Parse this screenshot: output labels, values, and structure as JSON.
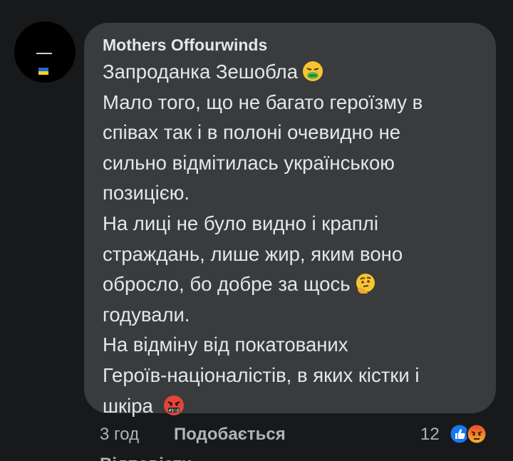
{
  "comment": {
    "author": "Mothers Offourwinds",
    "lines": [
      "Запроданка Зешобла",
      "Мало того, що не багато героїзму в",
      "співах так і в полоні очевидно не",
      "сильно відмітилась українською",
      "позицією.",
      "На лиці не було видно і краплі",
      "страждань, лише жир, яким воно",
      "обросло, бо добре за щось",
      "годували.",
      "На відміну від покатованих",
      "Героїв-націоналістів, в яких кістки і",
      "шкіра"
    ],
    "emojis": {
      "line_0": "nauseated-face-emoji",
      "line_7": "thinking-face-emoji",
      "line_11": "face-with-symbols-on-mouth-emoji"
    }
  },
  "footer": {
    "time": "3 год",
    "like_label": "Подобається",
    "reply_label": "Відповісти",
    "reaction_count": "12",
    "reaction_icons": [
      "like-reaction-icon",
      "angry-reaction-icon"
    ]
  },
  "colors": {
    "background": "#18191a",
    "bubble": "#3a3b3c",
    "text": "#e4e6eb",
    "secondary_text": "#b0b3b8",
    "like_blue": "#1877f2",
    "angry_orange": "#f0812d"
  },
  "avatar": {
    "badge": "ukraine-flag-icon"
  }
}
